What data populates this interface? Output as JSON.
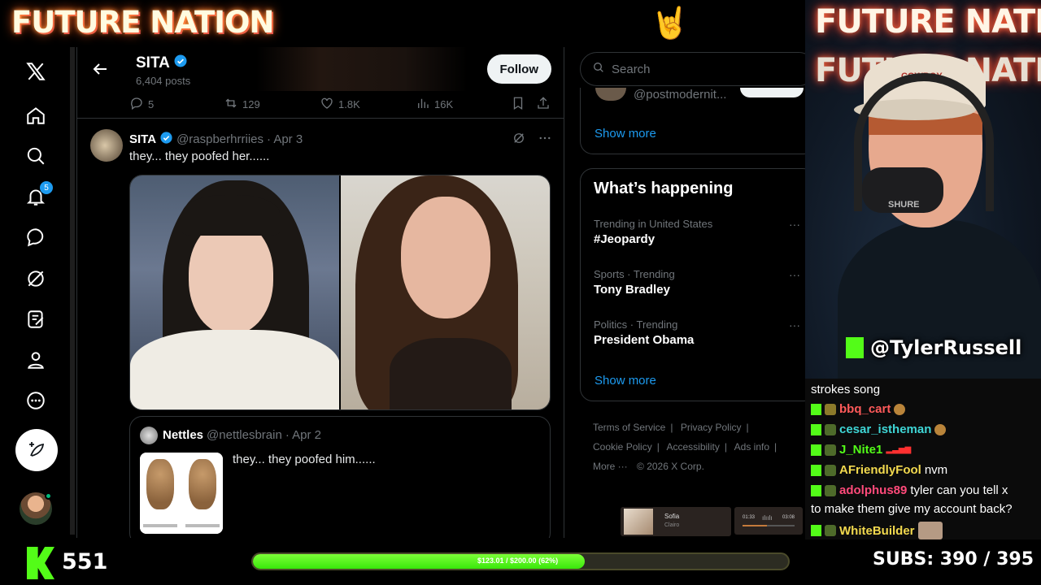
{
  "overlay": {
    "brand": "FUTURE NATION",
    "viewer_count": "551",
    "goal_label": "$123.01 / $200.00 (62%)",
    "goal_fraction": 0.62,
    "subs_label": "SUBS:",
    "subs_value": "390 / 395",
    "accent": "#53fc18"
  },
  "nav": {
    "icons": [
      "x-logo-icon",
      "home-icon",
      "explore-icon",
      "notifications-icon",
      "messages-icon",
      "grok-icon",
      "lists-icon",
      "profile-icon",
      "more-icon",
      "post-icon"
    ],
    "notification_badge": "5"
  },
  "header": {
    "profile_name": "SITA",
    "posts_count": "6,404 posts",
    "follow_label": "Follow"
  },
  "prev_actions": {
    "replies": "5",
    "reposts": "129",
    "likes": "1.8K",
    "views": "16K"
  },
  "tweet": {
    "name": "SITA",
    "handle": "@raspberhrriies",
    "date": "· Apr 3",
    "text": "they... they poofed her......"
  },
  "quote": {
    "name": "Nettles",
    "handle": "@nettlesbrain",
    "date": "· Apr 2",
    "text": "they... they poofed him......"
  },
  "sidebar": {
    "search_placeholder": "Search",
    "who_handle": "@postmodernit...",
    "show_more_1": "Show more",
    "whats_happening": "What’s happening",
    "trends": [
      {
        "context": "Trending in United States",
        "title": "#Jeopardy"
      },
      {
        "context": "Sports · Trending",
        "title": "Tony Bradley"
      },
      {
        "context": "Politics · Trending",
        "title": "President Obama"
      }
    ],
    "show_more_2": "Show more",
    "footer": {
      "terms": "Terms of Service",
      "privacy": "Privacy Policy",
      "cookie": "Cookie Policy",
      "accessibility": "Accessibility",
      "ads": "Ads info",
      "more": "More ···",
      "copyright": "© 2026 X Corp."
    }
  },
  "music": {
    "song": "Sofia",
    "artist": "Clairo",
    "elapsed": "01:33",
    "total": "03:08"
  },
  "cam": {
    "handle": "@TylerRussell",
    "hat_text": "COWBOY",
    "mic_brand": "SHURE"
  },
  "chat": [
    {
      "user": "",
      "color": "#ffffff",
      "text": "strokes song"
    },
    {
      "user": "bbq_cart",
      "color": "#ff5a5a",
      "text": ""
    },
    {
      "user": "cesar_istheman",
      "color": "#3fd6d6",
      "text": ""
    },
    {
      "user": "J_Nite1",
      "color": "#53fc18",
      "text": ""
    },
    {
      "user": "AFriendlyFool",
      "color": "#f2d94e",
      "text": "nvm"
    },
    {
      "user": "adolphus89",
      "color": "#ff4a7a",
      "text": "tyler can you tell x"
    },
    {
      "user": "",
      "color": "#ffffff",
      "text": "to make them give my account back?"
    },
    {
      "user": "WhiteBuilder",
      "color": "#f2d94e",
      "text": ""
    }
  ]
}
